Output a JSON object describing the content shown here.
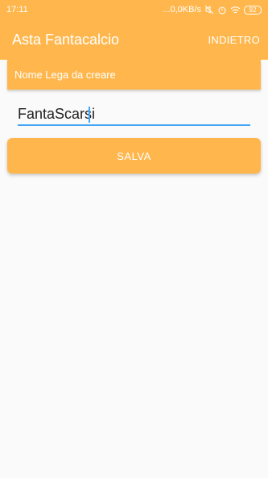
{
  "status_bar": {
    "time": "17:11",
    "network_speed": "...0,0KB/s",
    "battery": "92",
    "icons": [
      "mute-icon",
      "alarm-icon",
      "wifi-icon",
      "battery-icon"
    ]
  },
  "app_bar": {
    "title": "Asta Fantacalcio",
    "back_label": "INDIETRO"
  },
  "header": {
    "label": "Nome Lega da creare"
  },
  "form": {
    "league_name_value": "FantaScarsi"
  },
  "actions": {
    "save_label": "SALVA"
  },
  "colors": {
    "accent": "#ffb74d",
    "input_underline": "#42a5f5",
    "background": "#fafafa"
  }
}
